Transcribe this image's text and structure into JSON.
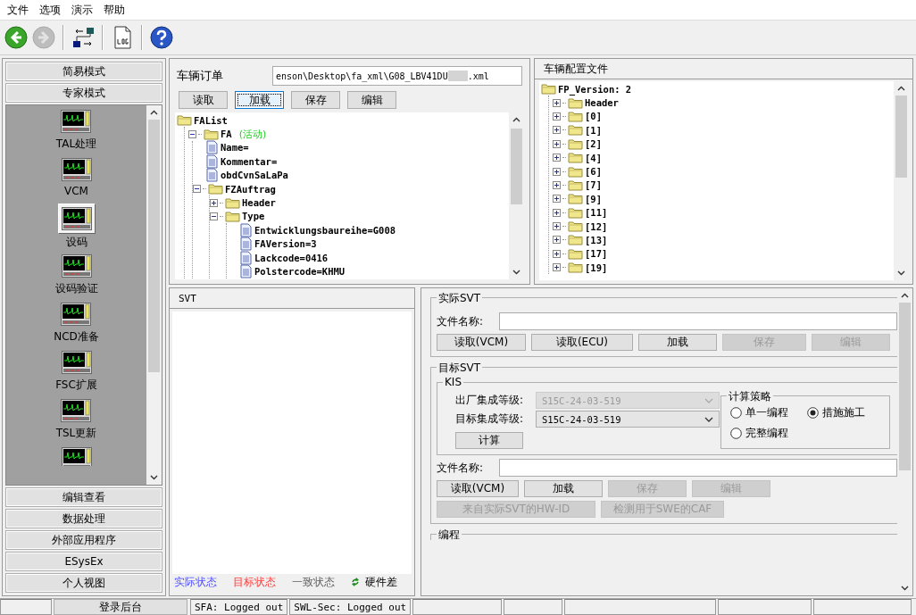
{
  "menu": [
    {
      "label": "文件"
    },
    {
      "label": "选项"
    },
    {
      "label": "演示"
    },
    {
      "label": "帮助"
    }
  ],
  "toolbar": [
    {
      "kind": "back",
      "disabled": false
    },
    {
      "kind": "forward",
      "disabled": true
    },
    {
      "kind": "network",
      "disabled": false
    },
    {
      "kind": "log",
      "disabled": false
    },
    {
      "kind": "help",
      "disabled": false
    }
  ],
  "sidebar": {
    "top_buttons": [
      "简易模式",
      "专家模式"
    ],
    "items": [
      {
        "label": "TAL处理",
        "selected": false
      },
      {
        "label": "VCM",
        "selected": false
      },
      {
        "label": "设码",
        "selected": true
      },
      {
        "label": "设码验证",
        "selected": false
      },
      {
        "label": "NCD准备",
        "selected": false
      },
      {
        "label": "FSC扩展",
        "selected": false
      },
      {
        "label": "TSL更新",
        "selected": false
      }
    ],
    "bottom_buttons": [
      "编辑查看",
      "数据处理",
      "外部应用程序",
      "ESysEx",
      "个人视图"
    ]
  },
  "order_panel": {
    "label": "车辆订单",
    "path": "enson\\Desktop\\fa_xml\\G08_LBV41DU",
    "path_end": ".xml",
    "buttons": [
      {
        "label": "读取",
        "focused": false
      },
      {
        "label": "加载",
        "focused": true
      },
      {
        "label": "保存",
        "focused": false
      },
      {
        "label": "编辑",
        "focused": false
      }
    ],
    "tree": [
      {
        "label": "FAList",
        "kind": "folder",
        "children": [
          {
            "label": "FA",
            "tag": "(活动)",
            "kind": "folder",
            "expanded": true,
            "children": [
              {
                "label": "Name=",
                "kind": "file"
              },
              {
                "label": "Kommentar=",
                "kind": "file"
              },
              {
                "label": "obdCvnSaLaPa",
                "kind": "file"
              },
              {
                "label": "FZAuftrag",
                "kind": "folder",
                "expanded": true,
                "children": [
                  {
                    "label": "Header",
                    "kind": "folder",
                    "expanded": false
                  },
                  {
                    "label": "Type",
                    "kind": "folder",
                    "expanded": true,
                    "children": [
                      {
                        "label": "Entwicklungsbaureihe=G008",
                        "kind": "file"
                      },
                      {
                        "label": "FAVersion=3",
                        "kind": "file"
                      },
                      {
                        "label": "Lackcode=0416",
                        "kind": "file"
                      },
                      {
                        "label": "Polstercode=KHMU",
                        "kind": "file"
                      }
                    ]
                  }
                ]
              }
            ]
          }
        ]
      }
    ]
  },
  "config_panel": {
    "title": "车辆配置文件",
    "tree": [
      {
        "label": "FP_Version: 2",
        "kind": "folder",
        "children": [
          {
            "label": "Header",
            "kind": "folder",
            "expanded": false
          },
          {
            "label": "[0]",
            "kind": "folder",
            "expanded": false
          },
          {
            "label": "[1]",
            "kind": "folder",
            "expanded": false
          },
          {
            "label": "[2]",
            "kind": "folder",
            "expanded": false
          },
          {
            "label": "[4]",
            "kind": "folder",
            "expanded": false
          },
          {
            "label": "[6]",
            "kind": "folder",
            "expanded": false
          },
          {
            "label": "[7]",
            "kind": "folder",
            "expanded": false
          },
          {
            "label": "[9]",
            "kind": "folder",
            "expanded": false
          },
          {
            "label": "[11]",
            "kind": "folder",
            "expanded": false
          },
          {
            "label": "[12]",
            "kind": "folder",
            "expanded": false
          },
          {
            "label": "[13]",
            "kind": "folder",
            "expanded": false
          },
          {
            "label": "[17]",
            "kind": "folder",
            "expanded": false
          },
          {
            "label": "[19]",
            "kind": "folder",
            "expanded": false
          }
        ]
      }
    ]
  },
  "svt_panel": {
    "title": "SVT",
    "legend": [
      {
        "label": "实际状态",
        "kind": "text",
        "color": "#5050ff"
      },
      {
        "label": "目标状态",
        "kind": "text",
        "color": "#ff4040"
      },
      {
        "label": "一致状态",
        "kind": "text",
        "color": "#606060"
      },
      {
        "label": "硬件差",
        "kind": "icon"
      }
    ]
  },
  "actual_svt": {
    "title": "实际SVT",
    "file_label": "文件名称:",
    "buttons": [
      {
        "label": "读取(VCM)",
        "disabled": false
      },
      {
        "label": "读取(ECU)",
        "disabled": false
      },
      {
        "label": "加载",
        "disabled": false
      },
      {
        "label": "保存",
        "disabled": true
      },
      {
        "label": "编辑",
        "disabled": true
      }
    ]
  },
  "target_svt": {
    "title": "目标SVT",
    "kis": {
      "title": "KIS",
      "fields": [
        {
          "label": "出厂集成等级:",
          "value": "S15C-24-03-519",
          "disabled": true
        },
        {
          "label": "目标集成等级:",
          "value": "S15C-24-03-519",
          "disabled": false
        }
      ],
      "button": "计算"
    },
    "strategy": {
      "title": "计算策略",
      "options": [
        {
          "label": "单一编程",
          "selected": false
        },
        {
          "label": "措施施工",
          "selected": true
        },
        {
          "label": "完整编程",
          "selected": false
        }
      ]
    },
    "file_label": "文件名称:",
    "buttons": [
      {
        "label": "读取(VCM)",
        "disabled": false
      },
      {
        "label": "加载",
        "disabled": false
      },
      {
        "label": "保存",
        "disabled": true
      },
      {
        "label": "编辑",
        "disabled": true
      }
    ],
    "extra_buttons": [
      {
        "label": "来自实际SVT的HW-ID",
        "disabled": true
      },
      {
        "label": "检测用于SWE的CAF",
        "disabled": true
      }
    ]
  },
  "programming": {
    "title": "编程"
  },
  "status_bar": {
    "login_button": "登录后台",
    "cells": [
      "SFA: Logged out",
      "SWL-Sec: Logged out"
    ]
  }
}
